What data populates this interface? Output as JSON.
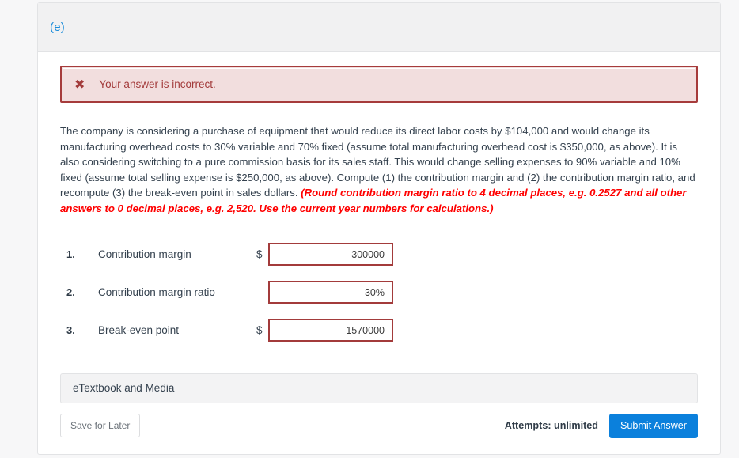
{
  "card": {
    "part_label": "(e)"
  },
  "alert": {
    "icon": "x-mark-icon",
    "icon_glyph": "✖",
    "message": "Your answer is incorrect.",
    "background_color": "#f2dede",
    "border_color": "#a63b3b",
    "text_color": "#a33b3b"
  },
  "prompt": {
    "part1": "The company is considering a purchase of equipment that would reduce its direct labor costs by $104,000 and would change its manufacturing overhead costs to 30% variable and 70% fixed (assume total manufacturing overhead cost is $350,000, as above). It is also considering switching to a pure commission basis for its sales staff. This would change selling expenses to 90% variable and 10% fixed (assume total selling expense is $250,000, as above). Compute (1) the contribution margin and (2) the contribution margin ratio, and recompute (3) the break-even point in sales dollars. ",
    "emphasis": "(Round contribution margin ratio to 4 decimal places, e.g. 0.2527 and all other answers to 0 decimal places, e.g. 2,520. Use the current year numbers for calculations.)",
    "emphasis_color": "#ff0000"
  },
  "answers": [
    {
      "number": "1.",
      "label": "Contribution margin",
      "currency": "$",
      "value": "300000",
      "placeholder": ""
    },
    {
      "number": "2.",
      "label": "Contribution margin ratio",
      "currency": "",
      "value": "30%",
      "placeholder": ""
    },
    {
      "number": "3.",
      "label": "Break-even point",
      "currency": "$",
      "value": "1570000",
      "placeholder": ""
    }
  ],
  "etextbook": {
    "label": "eTextbook and Media"
  },
  "footer": {
    "save_label": "Save for Later",
    "attempts_label": "Attempts: unlimited",
    "submit_label": "Submit Answer",
    "submit_color": "#0b80dc"
  }
}
